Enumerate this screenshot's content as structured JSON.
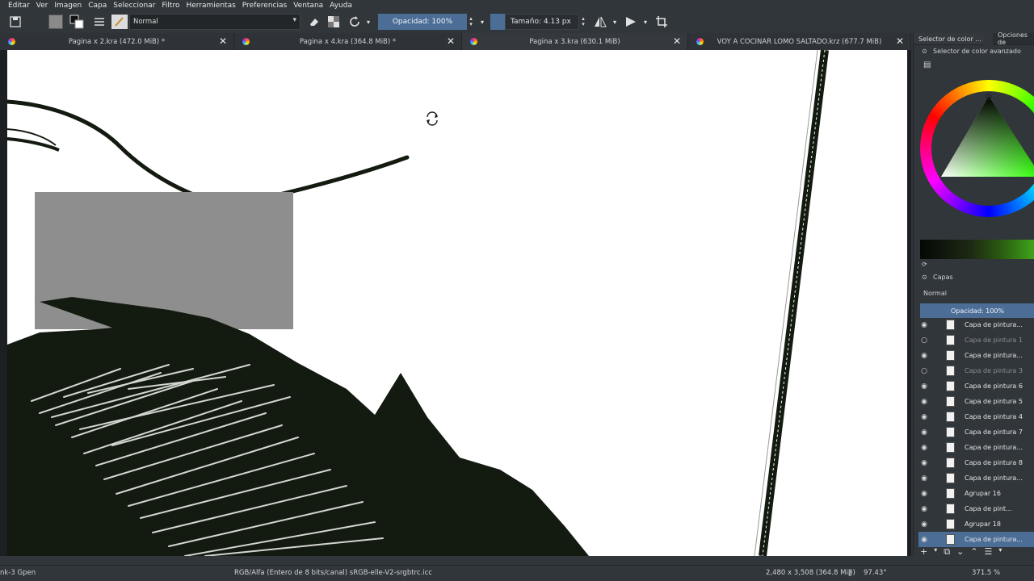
{
  "menu": [
    "Editar",
    "Ver",
    "Imagen",
    "Capa",
    "Seleccionar",
    "Filtro",
    "Herramientas",
    "Preferencias",
    "Ventana",
    "Ayuda"
  ],
  "toolbar": {
    "blend_mode": "Normal",
    "opacity": "Opacidad: 100%",
    "size": "Tamaño: 4.13 px"
  },
  "tabs": [
    {
      "label": "Pagina x 2.kra (472.0 MiB) *"
    },
    {
      "label": "Pagina x 4.kra (364.8 MiB) *"
    },
    {
      "label": "Pagina x 3.kra (630.1 MiB)"
    },
    {
      "label": "VOY A COCINAR LOMO SALTADO.krz (677.7 MiB)"
    }
  ],
  "docker": {
    "tab_color": "Selector de color ...",
    "tab_options": "Opciones de",
    "color_title": "Selector de color avanzado",
    "layers_title": "Capas",
    "layer_blend": "Normal",
    "layer_opacity": "Opacidad:  100%",
    "layers": [
      {
        "name": "Capa de pintura...",
        "visible": true,
        "dim": false
      },
      {
        "name": "Capa de pintura 1",
        "visible": false,
        "dim": true
      },
      {
        "name": "Capa de pintura...",
        "visible": true,
        "dim": false
      },
      {
        "name": "Capa de pintura 3",
        "visible": false,
        "dim": true
      },
      {
        "name": "Capa de pintura 6",
        "visible": true,
        "dim": false
      },
      {
        "name": "Capa de pintura 5",
        "visible": true,
        "dim": false
      },
      {
        "name": "Capa de pintura 4",
        "visible": true,
        "dim": false
      },
      {
        "name": "Capa de pintura 7",
        "visible": true,
        "dim": false
      },
      {
        "name": "Capa de pintura...",
        "visible": true,
        "dim": false
      },
      {
        "name": "Capa de pintura 8",
        "visible": true,
        "dim": false
      },
      {
        "name": "Capa de pintura...",
        "visible": true,
        "dim": false
      },
      {
        "name": "Agrupar 16",
        "visible": true,
        "dim": false
      },
      {
        "name": "Capa de pint...",
        "visible": true,
        "dim": false
      },
      {
        "name": "Agrupar 18",
        "visible": true,
        "dim": false
      },
      {
        "name": "Capa de pintura...",
        "visible": true,
        "dim": false,
        "selected": true
      }
    ]
  },
  "status": {
    "brush": "nk-3 Gpen",
    "color_space": "RGB/Alfa (Entero de 8 bits/canal)  sRGB-elle-V2-srgbtrc.icc",
    "dimensions": "2,480 x 3,508 (364.8 MiB)",
    "rotation": "97.43°",
    "zoom": "371.5 %"
  },
  "colors": {
    "accent": "#4c6e96",
    "ink": "#131a10"
  }
}
